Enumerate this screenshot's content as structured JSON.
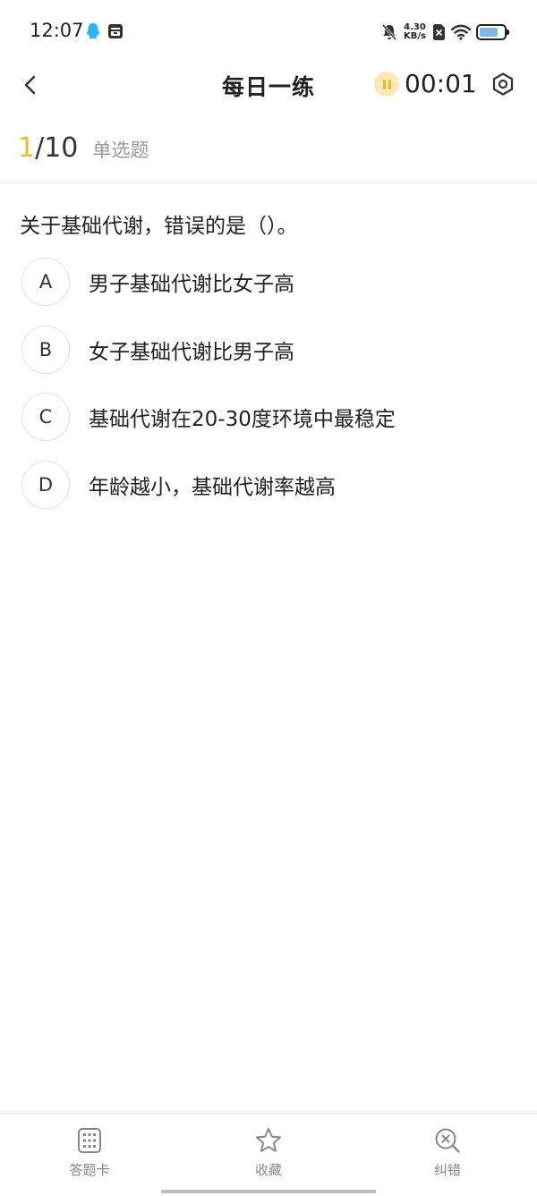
{
  "status_bar": {
    "time": "12:07",
    "net_speed_value": "4.30",
    "net_speed_unit": "KB/s",
    "battery_level": 0.75
  },
  "nav": {
    "title": "每日一练",
    "timer": "00:01"
  },
  "question_header": {
    "current": "1",
    "total": "/10",
    "type": "单选题"
  },
  "question": {
    "text": "关于基础代谢，错误的是（）。",
    "options": [
      {
        "letter": "A",
        "text": "男子基础代谢比女子高"
      },
      {
        "letter": "B",
        "text": "女子基础代谢比男子高"
      },
      {
        "letter": "C",
        "text": "基础代谢在20-30度环境中最稳定"
      },
      {
        "letter": "D",
        "text": "年龄越小，基础代谢率越高"
      }
    ]
  },
  "bottom_bar": {
    "answer_card": "答题卡",
    "favorite": "收藏",
    "report_error": "纠错"
  },
  "colors": {
    "accent": "#f0b92a",
    "qq": "#29b6f6"
  }
}
